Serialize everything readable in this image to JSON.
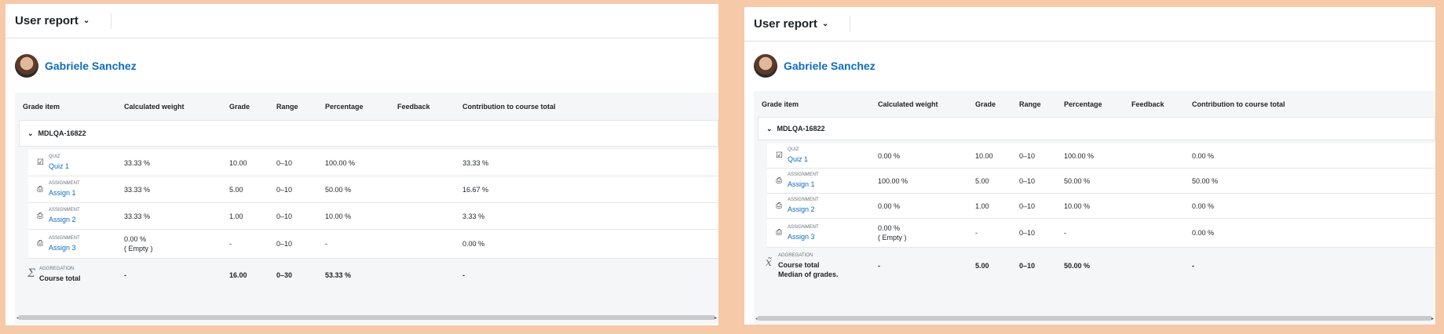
{
  "left": {
    "report_title": "User report",
    "user_name": "Gabriele Sanchez",
    "columns": [
      "Grade item",
      "Calculated weight",
      "Grade",
      "Range",
      "Percentage",
      "Feedback",
      "Contribution to course total"
    ],
    "category": "MDLQA-16822",
    "rows": [
      {
        "type": "QUIZ",
        "name": "Quiz 1",
        "weight": "33.33 %",
        "weight2": "",
        "grade": "10.00",
        "range": "0–10",
        "percentage": "100.00 %",
        "contribution": "33.33 %"
      },
      {
        "type": "ASSIGNMENT",
        "name": "Assign 1",
        "weight": "33.33 %",
        "weight2": "",
        "grade": "5.00",
        "range": "0–10",
        "percentage": "50.00 %",
        "contribution": "16.67 %"
      },
      {
        "type": "ASSIGNMENT",
        "name": "Assign 2",
        "weight": "33.33 %",
        "weight2": "",
        "grade": "1.00",
        "range": "0–10",
        "percentage": "10.00 %",
        "contribution": "3.33 %"
      },
      {
        "type": "ASSIGNMENT",
        "name": "Assign 3",
        "weight": "0.00 %",
        "weight2": "( Empty )",
        "grade": "-",
        "range": "0–10",
        "percentage": "-",
        "contribution": "0.00 %"
      }
    ],
    "total": {
      "type": "AGGREGATION",
      "name": "Course total",
      "note": "",
      "weight": "-",
      "grade": "16.00",
      "range": "0–30",
      "percentage": "53.33 %",
      "contribution": "-"
    }
  },
  "right": {
    "report_title": "User report",
    "user_name": "Gabriele Sanchez",
    "columns": [
      "Grade item",
      "Calculated weight",
      "Grade",
      "Range",
      "Percentage",
      "Feedback",
      "Contribution to course total"
    ],
    "category": "MDLQA-16822",
    "rows": [
      {
        "type": "QUIZ",
        "name": "Quiz 1",
        "weight": "0.00 %",
        "weight2": "",
        "grade": "10.00",
        "range": "0–10",
        "percentage": "100.00 %",
        "contribution": "0.00 %"
      },
      {
        "type": "ASSIGNMENT",
        "name": "Assign 1",
        "weight": "100.00 %",
        "weight2": "",
        "grade": "5.00",
        "range": "0–10",
        "percentage": "50.00 %",
        "contribution": "50.00 %"
      },
      {
        "type": "ASSIGNMENT",
        "name": "Assign 2",
        "weight": "0.00 %",
        "weight2": "",
        "grade": "1.00",
        "range": "0–10",
        "percentage": "10.00 %",
        "contribution": "0.00 %"
      },
      {
        "type": "ASSIGNMENT",
        "name": "Assign 3",
        "weight": "0.00 %",
        "weight2": "( Empty )",
        "grade": "-",
        "range": "0–10",
        "percentage": "-",
        "contribution": "0.00 %"
      }
    ],
    "total": {
      "type": "AGGREGATION",
      "name": "Course total",
      "note": "Median of grades.",
      "weight": "-",
      "grade": "5.00",
      "range": "0–10",
      "percentage": "50.00 %",
      "contribution": "-"
    }
  }
}
